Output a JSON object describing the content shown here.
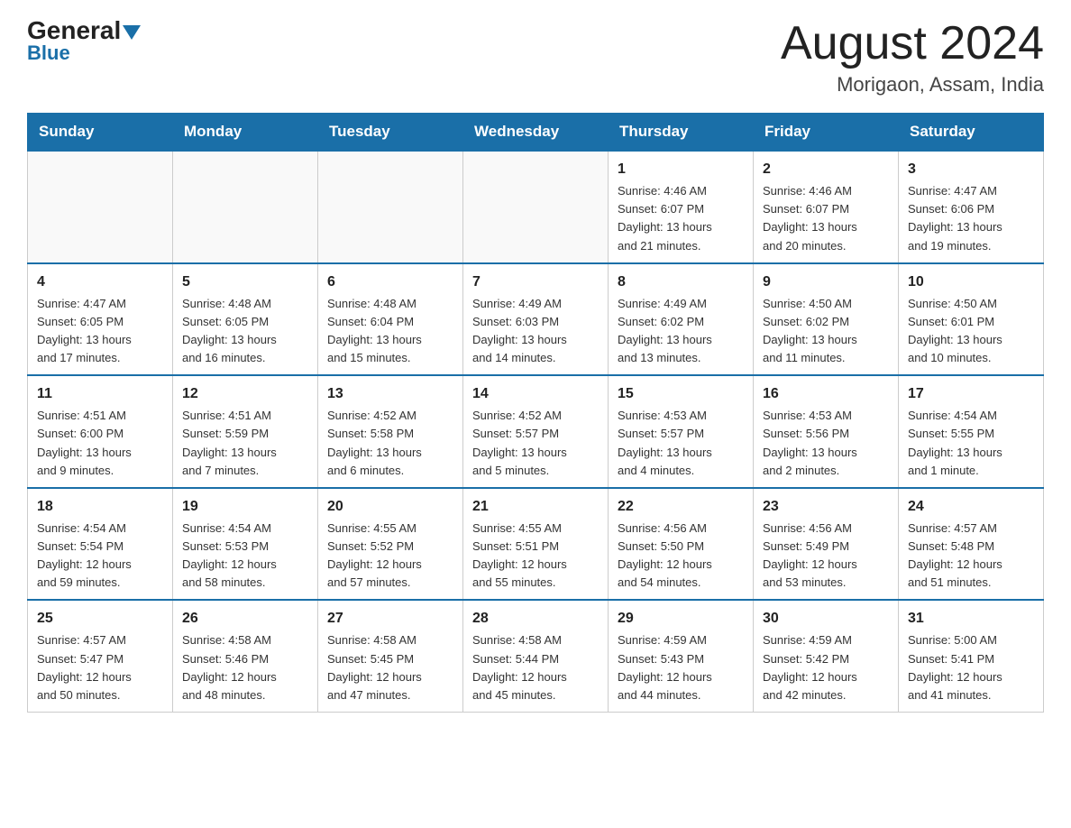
{
  "header": {
    "logo_general": "General",
    "logo_blue": "Blue",
    "month": "August 2024",
    "location": "Morigaon, Assam, India"
  },
  "days_of_week": [
    "Sunday",
    "Monday",
    "Tuesday",
    "Wednesday",
    "Thursday",
    "Friday",
    "Saturday"
  ],
  "weeks": [
    [
      {
        "day": "",
        "info": ""
      },
      {
        "day": "",
        "info": ""
      },
      {
        "day": "",
        "info": ""
      },
      {
        "day": "",
        "info": ""
      },
      {
        "day": "1",
        "info": "Sunrise: 4:46 AM\nSunset: 6:07 PM\nDaylight: 13 hours\nand 21 minutes."
      },
      {
        "day": "2",
        "info": "Sunrise: 4:46 AM\nSunset: 6:07 PM\nDaylight: 13 hours\nand 20 minutes."
      },
      {
        "day": "3",
        "info": "Sunrise: 4:47 AM\nSunset: 6:06 PM\nDaylight: 13 hours\nand 19 minutes."
      }
    ],
    [
      {
        "day": "4",
        "info": "Sunrise: 4:47 AM\nSunset: 6:05 PM\nDaylight: 13 hours\nand 17 minutes."
      },
      {
        "day": "5",
        "info": "Sunrise: 4:48 AM\nSunset: 6:05 PM\nDaylight: 13 hours\nand 16 minutes."
      },
      {
        "day": "6",
        "info": "Sunrise: 4:48 AM\nSunset: 6:04 PM\nDaylight: 13 hours\nand 15 minutes."
      },
      {
        "day": "7",
        "info": "Sunrise: 4:49 AM\nSunset: 6:03 PM\nDaylight: 13 hours\nand 14 minutes."
      },
      {
        "day": "8",
        "info": "Sunrise: 4:49 AM\nSunset: 6:02 PM\nDaylight: 13 hours\nand 13 minutes."
      },
      {
        "day": "9",
        "info": "Sunrise: 4:50 AM\nSunset: 6:02 PM\nDaylight: 13 hours\nand 11 minutes."
      },
      {
        "day": "10",
        "info": "Sunrise: 4:50 AM\nSunset: 6:01 PM\nDaylight: 13 hours\nand 10 minutes."
      }
    ],
    [
      {
        "day": "11",
        "info": "Sunrise: 4:51 AM\nSunset: 6:00 PM\nDaylight: 13 hours\nand 9 minutes."
      },
      {
        "day": "12",
        "info": "Sunrise: 4:51 AM\nSunset: 5:59 PM\nDaylight: 13 hours\nand 7 minutes."
      },
      {
        "day": "13",
        "info": "Sunrise: 4:52 AM\nSunset: 5:58 PM\nDaylight: 13 hours\nand 6 minutes."
      },
      {
        "day": "14",
        "info": "Sunrise: 4:52 AM\nSunset: 5:57 PM\nDaylight: 13 hours\nand 5 minutes."
      },
      {
        "day": "15",
        "info": "Sunrise: 4:53 AM\nSunset: 5:57 PM\nDaylight: 13 hours\nand 4 minutes."
      },
      {
        "day": "16",
        "info": "Sunrise: 4:53 AM\nSunset: 5:56 PM\nDaylight: 13 hours\nand 2 minutes."
      },
      {
        "day": "17",
        "info": "Sunrise: 4:54 AM\nSunset: 5:55 PM\nDaylight: 13 hours\nand 1 minute."
      }
    ],
    [
      {
        "day": "18",
        "info": "Sunrise: 4:54 AM\nSunset: 5:54 PM\nDaylight: 12 hours\nand 59 minutes."
      },
      {
        "day": "19",
        "info": "Sunrise: 4:54 AM\nSunset: 5:53 PM\nDaylight: 12 hours\nand 58 minutes."
      },
      {
        "day": "20",
        "info": "Sunrise: 4:55 AM\nSunset: 5:52 PM\nDaylight: 12 hours\nand 57 minutes."
      },
      {
        "day": "21",
        "info": "Sunrise: 4:55 AM\nSunset: 5:51 PM\nDaylight: 12 hours\nand 55 minutes."
      },
      {
        "day": "22",
        "info": "Sunrise: 4:56 AM\nSunset: 5:50 PM\nDaylight: 12 hours\nand 54 minutes."
      },
      {
        "day": "23",
        "info": "Sunrise: 4:56 AM\nSunset: 5:49 PM\nDaylight: 12 hours\nand 53 minutes."
      },
      {
        "day": "24",
        "info": "Sunrise: 4:57 AM\nSunset: 5:48 PM\nDaylight: 12 hours\nand 51 minutes."
      }
    ],
    [
      {
        "day": "25",
        "info": "Sunrise: 4:57 AM\nSunset: 5:47 PM\nDaylight: 12 hours\nand 50 minutes."
      },
      {
        "day": "26",
        "info": "Sunrise: 4:58 AM\nSunset: 5:46 PM\nDaylight: 12 hours\nand 48 minutes."
      },
      {
        "day": "27",
        "info": "Sunrise: 4:58 AM\nSunset: 5:45 PM\nDaylight: 12 hours\nand 47 minutes."
      },
      {
        "day": "28",
        "info": "Sunrise: 4:58 AM\nSunset: 5:44 PM\nDaylight: 12 hours\nand 45 minutes."
      },
      {
        "day": "29",
        "info": "Sunrise: 4:59 AM\nSunset: 5:43 PM\nDaylight: 12 hours\nand 44 minutes."
      },
      {
        "day": "30",
        "info": "Sunrise: 4:59 AM\nSunset: 5:42 PM\nDaylight: 12 hours\nand 42 minutes."
      },
      {
        "day": "31",
        "info": "Sunrise: 5:00 AM\nSunset: 5:41 PM\nDaylight: 12 hours\nand 41 minutes."
      }
    ]
  ]
}
